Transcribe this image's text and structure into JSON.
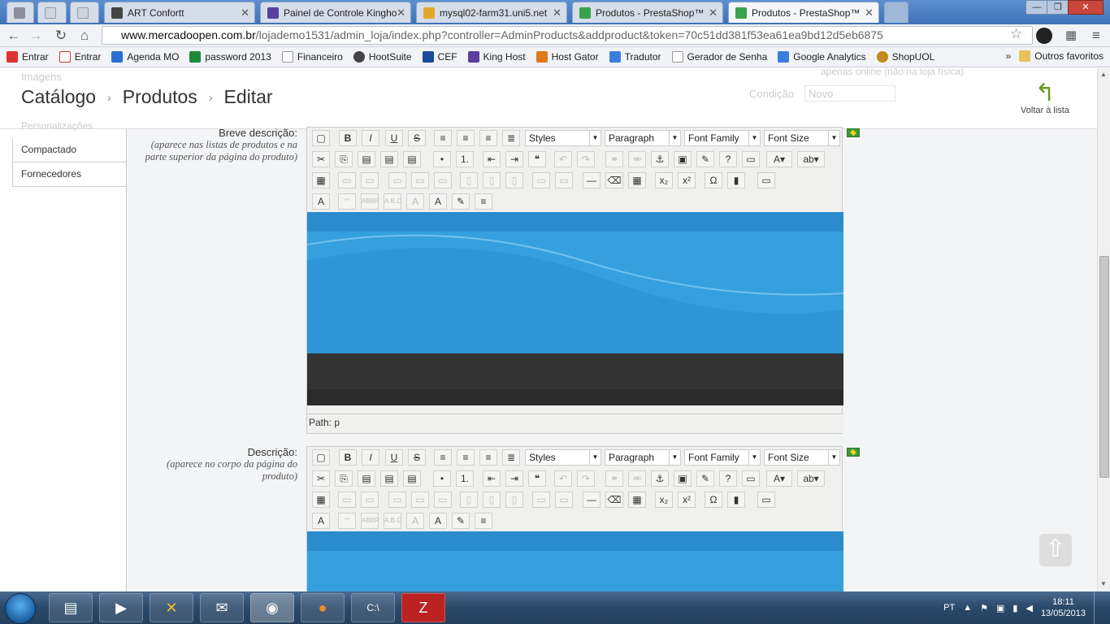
{
  "browser": {
    "tabs": [
      {
        "title": "",
        "favicon_color": "#8a8f99",
        "active": false
      },
      {
        "title": "",
        "favicon_color": "#cfd5de",
        "active": false
      },
      {
        "title": "",
        "favicon_color": "#cfd5de",
        "active": false
      },
      {
        "title": "ART Confortt",
        "favicon_color": "#444444",
        "active": false
      },
      {
        "title": "Painel de Controle Kingho",
        "favicon_color": "#5a3fa0",
        "active": false
      },
      {
        "title": "mysql02-farm31.uni5.net",
        "favicon_color": "#e3a82b",
        "active": false
      },
      {
        "title": "Produtos - PrestaShop™",
        "favicon_color": "#3aa24d",
        "active": false
      },
      {
        "title": "Produtos - PrestaShop™",
        "favicon_color": "#3aa24d",
        "active": true
      }
    ],
    "url_domain": "www.mercadoopen.com.br",
    "url_path": "/lojademo1531/admin_loja/index.php?controller=AdminProducts&addproduct&token=70c51dd381f53ea61ea9bd12d5eb6875",
    "bookmarks": [
      {
        "label": "Entrar",
        "color": "#d33"
      },
      {
        "label": "Entrar",
        "color": "#c33"
      },
      {
        "label": "Agenda MO",
        "color": "#2b6fd1"
      },
      {
        "label": "password 2013",
        "color": "#1c8a3a"
      },
      {
        "label": "Financeiro",
        "color": "#999"
      },
      {
        "label": "HootSuite",
        "color": "#444"
      },
      {
        "label": "CEF",
        "color": "#1a4a9a"
      },
      {
        "label": "King Host",
        "color": "#5a3fa0"
      },
      {
        "label": "Host Gator",
        "color": "#e07a1a"
      },
      {
        "label": "Tradutor",
        "color": "#3a7de0"
      },
      {
        "label": "Gerador de Senha",
        "color": "#999"
      },
      {
        "label": "Google Analytics",
        "color": "#3a7de0"
      },
      {
        "label": "ShopUOL",
        "color": "#c58a1a"
      }
    ],
    "bookmarks_more": "»",
    "other_bookmarks": "Outros favoritos"
  },
  "page": {
    "breadcrumb": [
      "Catálogo",
      "Produtos",
      "Editar"
    ],
    "back_label": "Voltar à lista",
    "ghost_top": "Imagens",
    "ghost_side": "Personalizações",
    "ghost_right1": "apenas online (não na loja física)",
    "ghost_right2_label": "Condição",
    "ghost_right2_value": "Novo",
    "left_menu": [
      "Compactado",
      "Fornecedores"
    ],
    "short_desc_label": "Breve descrição:",
    "short_desc_hint": "(aparece nas listas de produtos e na parte superior da página do produto)",
    "desc_label": "Descrição:",
    "desc_hint": "(aparece no corpo da página do produto)",
    "editor": {
      "styles": "Styles",
      "format": "Paragraph",
      "font_family": "Font Family",
      "font_size": "Font Size",
      "path": "Path: p"
    }
  },
  "taskbar": {
    "lang": "PT",
    "time": "18:11",
    "date": "13/05/2013"
  }
}
